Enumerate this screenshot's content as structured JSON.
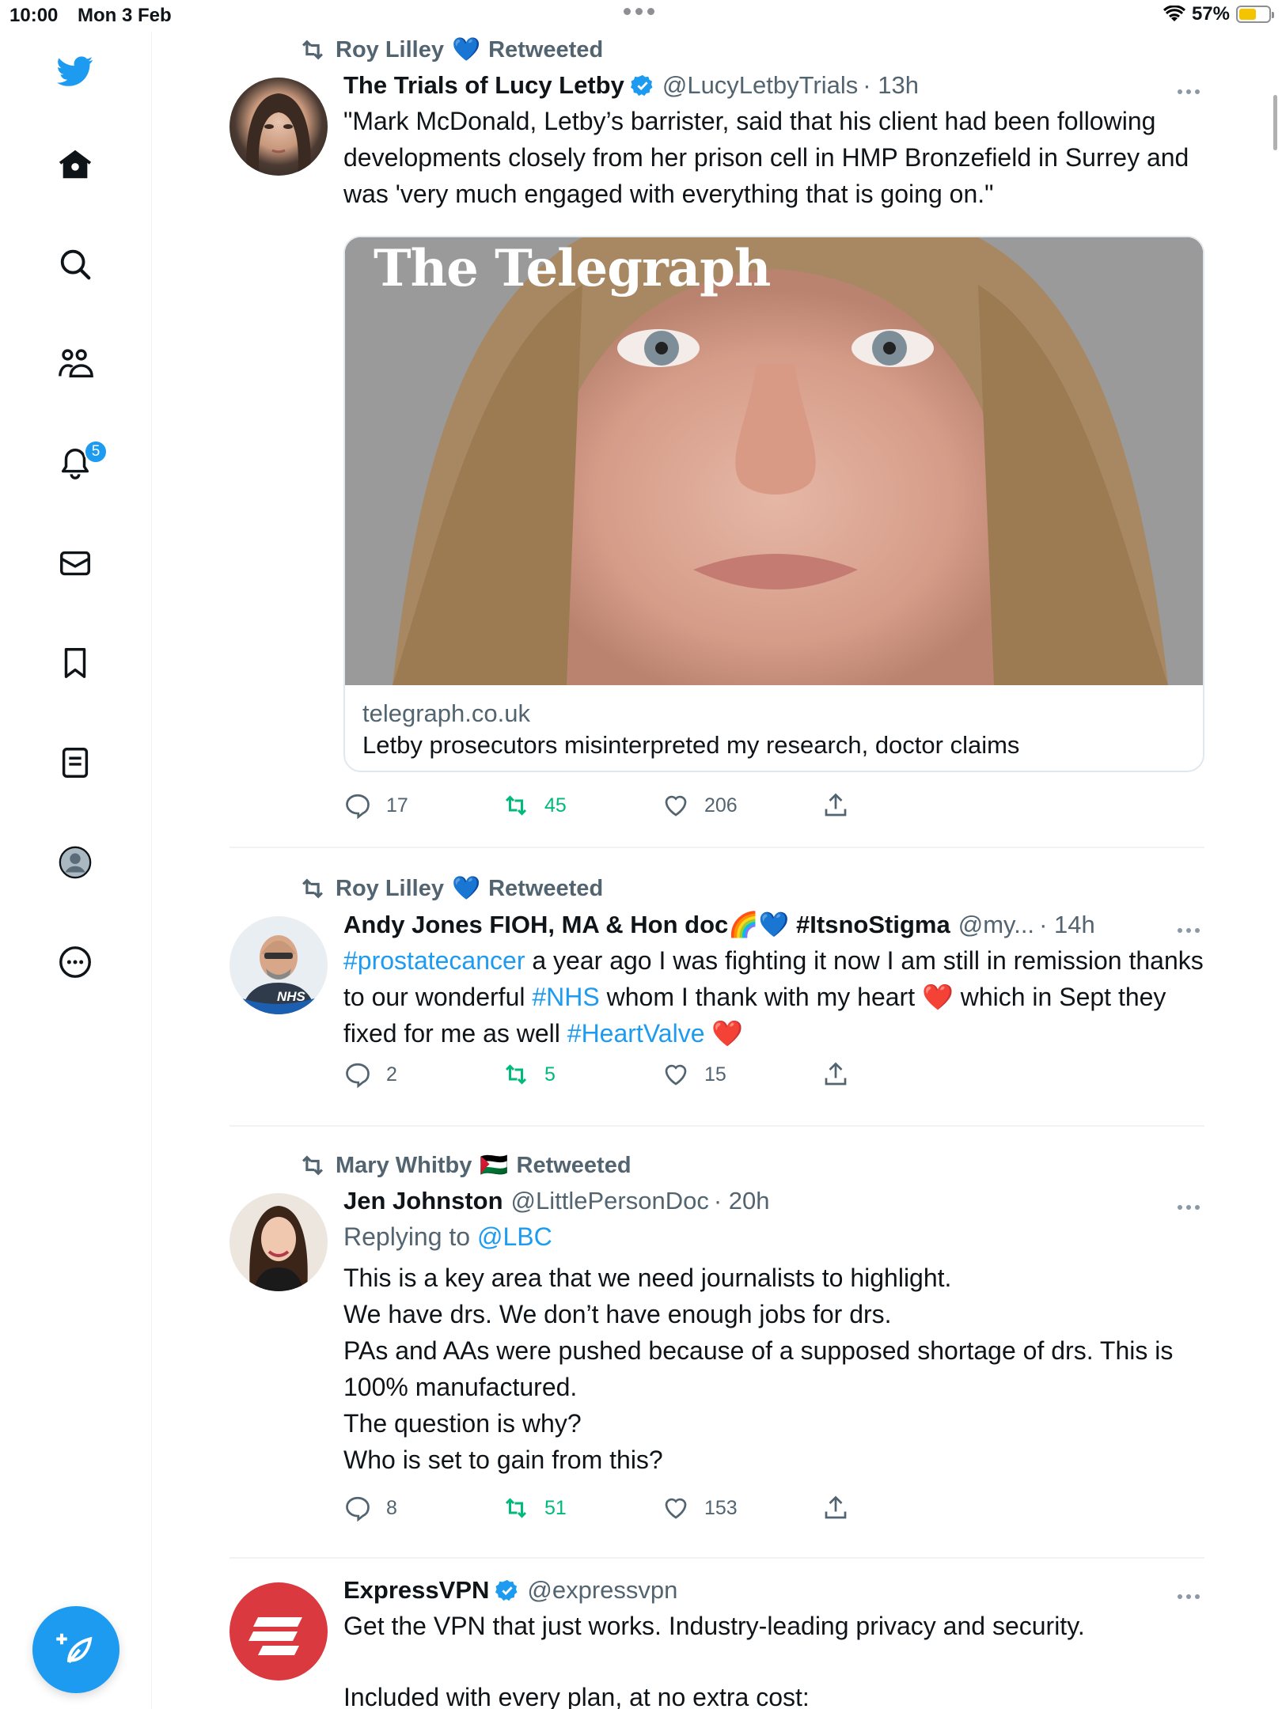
{
  "status_bar": {
    "time": "10:00",
    "date": "Mon 3 Feb",
    "battery": "57%",
    "battery_level": 0.57
  },
  "sidebar": {
    "notifications_badge": "5"
  },
  "tweets": [
    {
      "retweeted_by": "Roy Lilley",
      "retweeted_by_emoji": "💙",
      "retweet_label": "Retweeted",
      "author_name": "The Trials of Lucy Letby",
      "handle": "@LucyLetbyTrials",
      "time": "· 13h",
      "text": "\"Mark McDonald, Letby’s barrister, said that his client had been following developments closely from her prison cell in HMP Bronzefield in Surrey and was 'very much engaged with everything that is going on.\"",
      "card": {
        "masthead": "The Telegraph",
        "domain": "telegraph.co.uk",
        "title": "Letby prosecutors misinterpreted my research, doctor claims"
      },
      "replies": "17",
      "retweets": "45",
      "likes": "206"
    },
    {
      "retweeted_by": "Roy Lilley",
      "retweeted_by_emoji": "💙",
      "retweet_label": "Retweeted",
      "author_name": "Andy Jones FIOH, MA & Hon doc🌈💙 #ItsnoStigma",
      "handle": "@my...",
      "time": "· 14h",
      "text_parts": [
        {
          "text": "#prostatecancer",
          "link": true
        },
        {
          "text": " a year ago I was fighting  it now I am still in remission thanks to our wonderful ",
          "link": false
        },
        {
          "text": "#NHS",
          "link": true
        },
        {
          "text": " whom I thank with my heart ❤️ which in Sept they fixed for me as well ",
          "link": false
        },
        {
          "text": "#HeartValve",
          "link": true
        },
        {
          "text": " ❤️",
          "link": false
        }
      ],
      "avatar_caption": "NHS",
      "replies": "2",
      "retweets": "5",
      "likes": "15"
    },
    {
      "retweeted_by": "Mary Whitby",
      "retweeted_by_emoji": "🇵🇸",
      "retweet_label": "Retweeted",
      "author_name": "Jen Johnston",
      "handle": "@LittlePersonDoc",
      "time": "· 20h",
      "replying_prefix": "Replying to",
      "replying_to": "@LBC",
      "text_lines": [
        "This is a key area that we need journalists to highlight.",
        "We have drs. We don’t have enough jobs for drs.",
        "PAs and AAs were pushed because of a supposed shortage of drs. This is 100% manufactured.",
        "The question is why?",
        "Who is set to gain from this?"
      ],
      "replies": "8",
      "retweets": "51",
      "likes": "153"
    },
    {
      "author_name": "ExpressVPN",
      "handle": "@expressvpn",
      "text": "Get the VPN that just works. Industry-leading privacy and security.",
      "text2": "Included with every plan, at no extra cost:"
    }
  ],
  "colors": {
    "accent": "#1d9bf0",
    "retweet_green": "#00ba7c",
    "muted": "#536471",
    "express_red": "#da3940"
  }
}
